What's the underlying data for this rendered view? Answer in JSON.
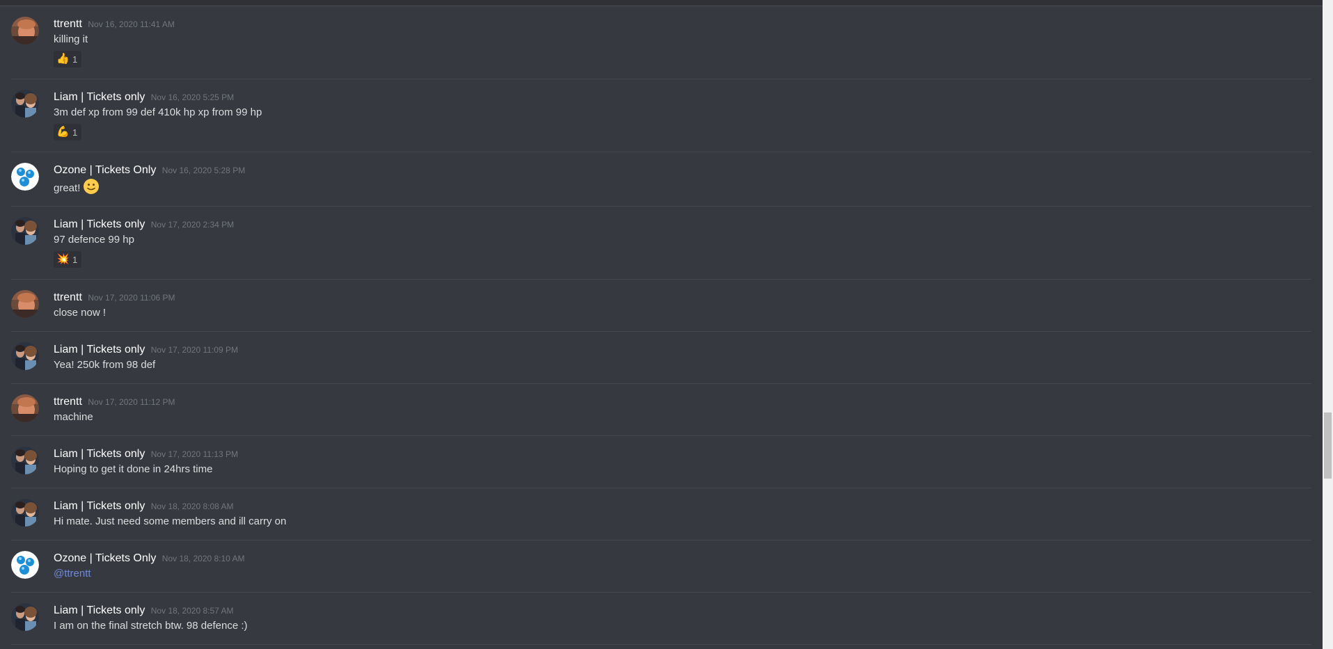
{
  "messages": [
    {
      "author": "ttrentt",
      "timestamp": "Nov 16, 2020 11:41 AM",
      "text": "killing it",
      "avatar": "ttrentt-avatar",
      "reactions": [
        {
          "emoji": "👍",
          "name": "thumbs-up",
          "count": "1"
        }
      ]
    },
    {
      "author": "Liam | Tickets only",
      "timestamp": "Nov 16, 2020 5:25 PM",
      "text": "3m def xp from 99 def 410k hp xp from 99 hp",
      "avatar": "liam-avatar",
      "reactions": [
        {
          "emoji": "💪",
          "name": "flexed-biceps",
          "count": "1"
        }
      ]
    },
    {
      "author": "Ozone | Tickets Only",
      "timestamp": "Nov 16, 2020 5:28 PM",
      "text": "great!",
      "avatar": "ozone-avatar",
      "inline_emoji": "slight-smile"
    },
    {
      "author": "Liam | Tickets only",
      "timestamp": "Nov 17, 2020 2:34 PM",
      "text": "97 defence 99 hp",
      "avatar": "liam-avatar",
      "reactions": [
        {
          "emoji": "💥",
          "name": "collision",
          "count": "1"
        }
      ]
    },
    {
      "author": "ttrentt",
      "timestamp": "Nov 17, 2020 11:06 PM",
      "text": "close now !",
      "avatar": "ttrentt-avatar"
    },
    {
      "author": "Liam | Tickets only",
      "timestamp": "Nov 17, 2020 11:09 PM",
      "text": "Yea! 250k from 98 def",
      "avatar": "liam-avatar"
    },
    {
      "author": "ttrentt",
      "timestamp": "Nov 17, 2020 11:12 PM",
      "text": "machine",
      "avatar": "ttrentt-avatar"
    },
    {
      "author": "Liam | Tickets only",
      "timestamp": "Nov 17, 2020 11:13 PM",
      "text": "Hoping to get it done in 24hrs time",
      "avatar": "liam-avatar"
    },
    {
      "author": "Liam | Tickets only",
      "timestamp": "Nov 18, 2020 8:08 AM",
      "text": "Hi mate. Just need some members and ill carry on",
      "avatar": "liam-avatar"
    },
    {
      "author": "Ozone | Tickets Only",
      "timestamp": "Nov 18, 2020 8:10 AM",
      "text": "@ttrentt",
      "avatar": "ozone-avatar",
      "mention": true
    },
    {
      "author": "Liam | Tickets only",
      "timestamp": "Nov 18, 2020 8:57 AM",
      "text": "I am on the final stretch btw. 98 defence :)",
      "avatar": "liam-avatar"
    }
  ],
  "colors": {
    "background": "#36393f",
    "author": "#ffffff",
    "timestamp": "#72767d",
    "text": "#dcddde",
    "mention": "#7289da",
    "divider": "#44474d",
    "reaction_bg": "#2f3136"
  }
}
